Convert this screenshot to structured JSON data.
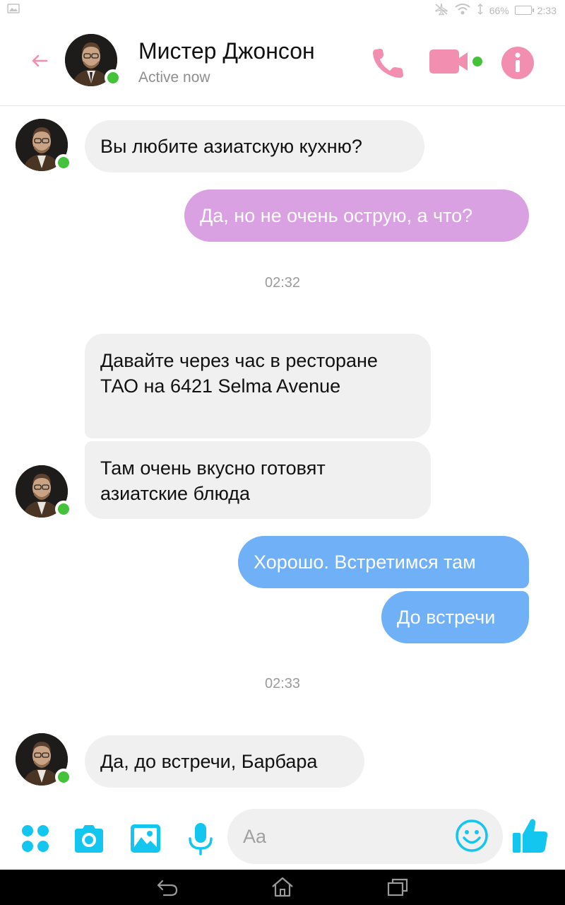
{
  "status_bar": {
    "battery": "66%",
    "time": "2:33"
  },
  "header": {
    "contact_name": "Мистер Джонсон",
    "status": "Active now"
  },
  "messages": [
    {
      "from": "contact",
      "text": "Вы любите азиатскую кухню?"
    },
    {
      "from": "me",
      "text": "Да, но не очень острую, а что?"
    },
    {
      "timestamp": "02:32"
    },
    {
      "from": "contact",
      "text": "Давайте через час в ресторане ТАО на 6421 Selma Avenue"
    },
    {
      "from": "contact",
      "text": "Там очень вкусно готовят азиатские блюда"
    },
    {
      "from": "me",
      "text": "Хорошо. Встретимся там"
    },
    {
      "from": "me",
      "text": "До встречи"
    },
    {
      "timestamp": "02:33"
    },
    {
      "from": "contact",
      "text": "Да, до встречи, Барбара"
    }
  ],
  "composer": {
    "placeholder": "Aa"
  },
  "colors": {
    "accent_pink": "#f28fb0",
    "bubble_outgoing_pink": "#d9a0e2",
    "bubble_outgoing_blue": "#6fb0f7",
    "bubble_incoming": "#f1f0f0",
    "tool_cyan": "#13c6f0",
    "online_green": "#44c23a"
  },
  "icons": [
    "back-arrow-icon",
    "phone-icon",
    "video-camera-icon",
    "info-icon",
    "apps-icon",
    "camera-icon",
    "image-icon",
    "microphone-icon",
    "emoji-icon",
    "thumbs-up-icon",
    "nav-back-icon",
    "nav-home-icon",
    "nav-recents-icon"
  ]
}
